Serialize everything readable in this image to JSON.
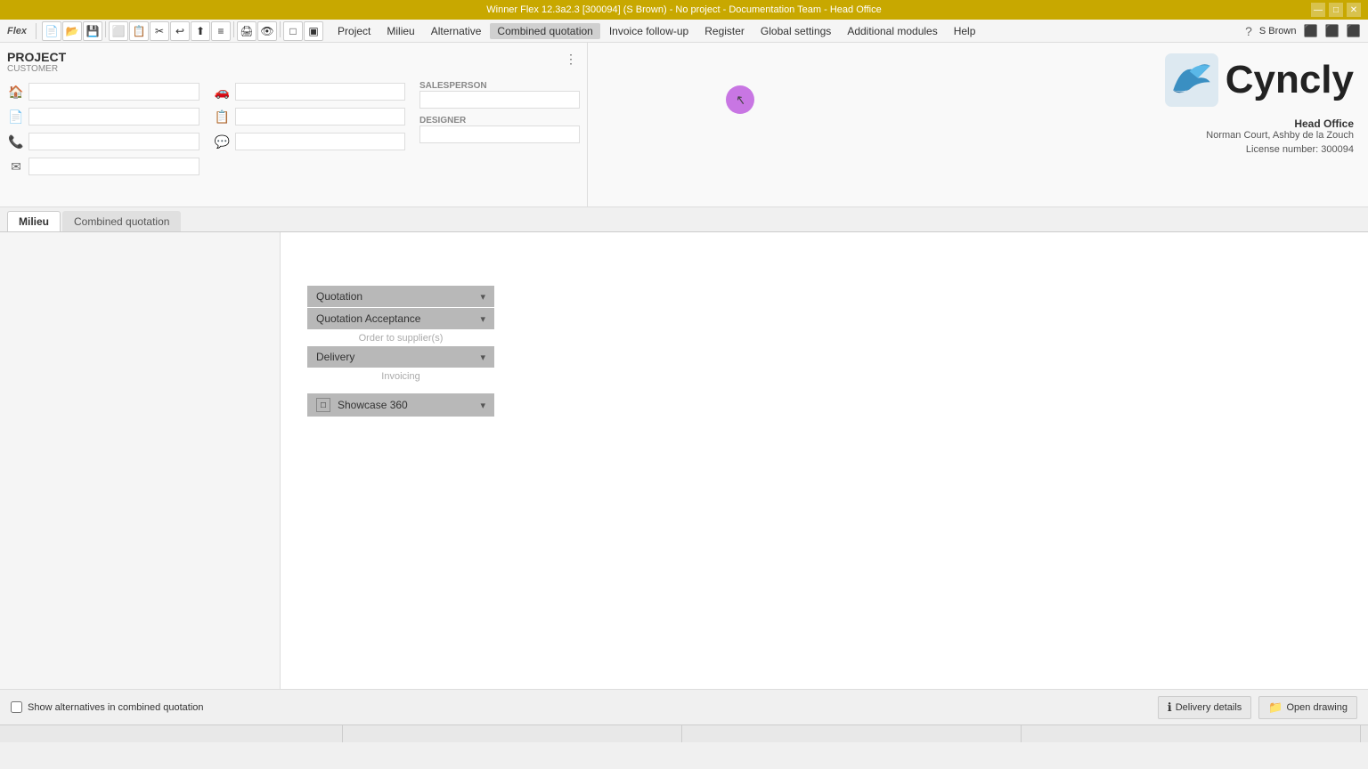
{
  "titleBar": {
    "text": "Winner Flex 12.3a2.3 [300094] (S Brown) - No project - Documentation Team - Head Office",
    "minimize": "—",
    "maximize": "□",
    "close": "✕"
  },
  "menuBar": {
    "items": [
      {
        "label": "Project",
        "active": false
      },
      {
        "label": "Milieu",
        "active": false
      },
      {
        "label": "Alternative",
        "active": false
      },
      {
        "label": "Combined quotation",
        "active": true
      },
      {
        "label": "Invoice follow-up",
        "active": false
      },
      {
        "label": "Register",
        "active": false
      },
      {
        "label": "Global settings",
        "active": false
      },
      {
        "label": "Additional modules",
        "active": false
      },
      {
        "label": "Help",
        "active": false
      }
    ],
    "flexLabel": "Flex",
    "userIcon": "?",
    "userName": "S Brown"
  },
  "project": {
    "title": "PROJECT",
    "subtitle": "CUSTOMER",
    "salespersonLabel": "SALESPERSON",
    "designerLabel": "DESIGNER"
  },
  "company": {
    "name": "Head Office",
    "address": "Norman Court,  Ashby de la Zouch",
    "license": "License number: 300094"
  },
  "tabs": [
    {
      "label": "Milieu",
      "active": true
    },
    {
      "label": "Combined quotation",
      "active": false
    }
  ],
  "workflow": {
    "items": [
      {
        "label": "Quotation",
        "hasChevron": true
      },
      {
        "label": "Quotation Acceptance",
        "hasChevron": true
      },
      {
        "label": "Order to supplier(s)",
        "isLight": true
      },
      {
        "label": "Delivery",
        "hasChevron": true
      },
      {
        "label": "Invoicing",
        "isLight": true
      }
    ],
    "showcase": {
      "label": "Showcase 360",
      "hasChevron": true
    }
  },
  "bottomBar": {
    "checkboxLabel": "Show alternatives in combined quotation",
    "deliveryDetails": "Delivery details",
    "openDrawing": "Open drawing"
  },
  "icons": {
    "home": "🏠",
    "car": "🚗",
    "phone": "📞",
    "email": "✉",
    "msg1": "💬",
    "msg2": "💬",
    "doc1": "📄",
    "doc2": "📋",
    "info": "ℹ"
  }
}
